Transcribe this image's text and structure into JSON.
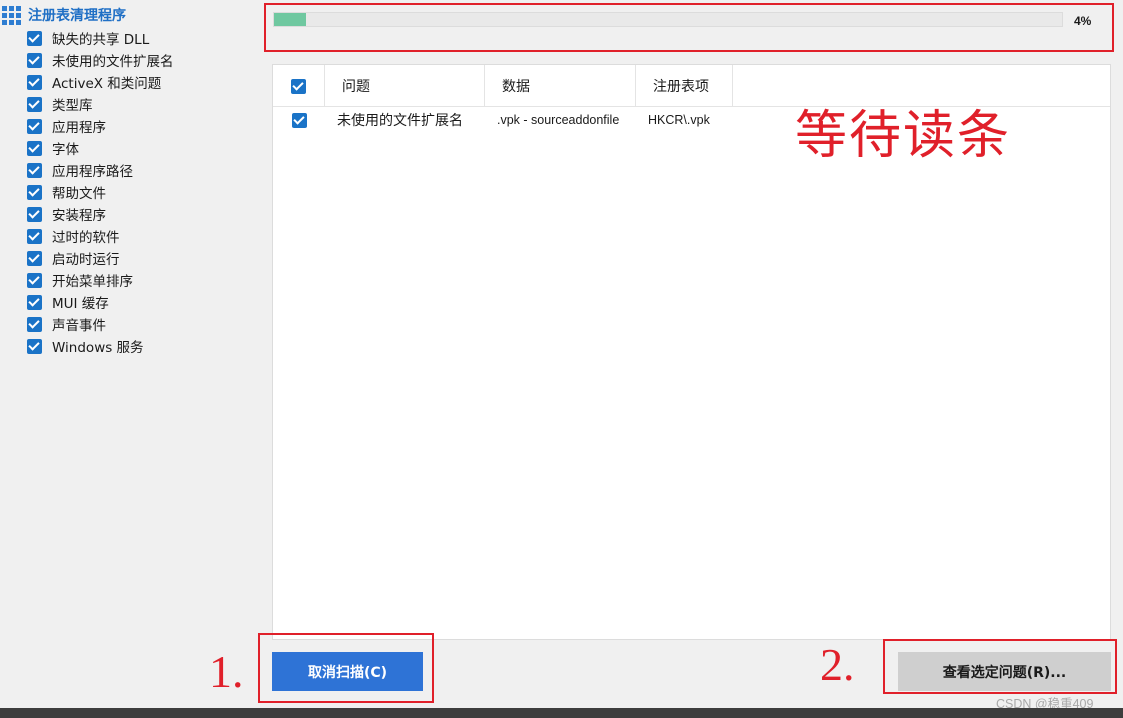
{
  "sidebar": {
    "root_label": "注册表清理程序",
    "items": [
      {
        "label": "缺失的共享 DLL",
        "checked": true
      },
      {
        "label": "未使用的文件扩展名",
        "checked": true
      },
      {
        "label": "ActiveX 和类问题",
        "checked": true
      },
      {
        "label": "类型库",
        "checked": true
      },
      {
        "label": "应用程序",
        "checked": true
      },
      {
        "label": "字体",
        "checked": true
      },
      {
        "label": "应用程序路径",
        "checked": true
      },
      {
        "label": "帮助文件",
        "checked": true
      },
      {
        "label": "安装程序",
        "checked": true
      },
      {
        "label": "过时的软件",
        "checked": true
      },
      {
        "label": "启动时运行",
        "checked": true
      },
      {
        "label": "开始菜单排序",
        "checked": true
      },
      {
        "label": "MUI 缓存",
        "checked": true
      },
      {
        "label": "声音事件",
        "checked": true
      },
      {
        "label": "Windows 服务",
        "checked": true
      }
    ]
  },
  "progress": {
    "percent_label": "4%",
    "value": 0.04
  },
  "table": {
    "columns": [
      "问题",
      "数据",
      "注册表项"
    ],
    "select_all_checked": true,
    "rows": [
      {
        "checked": true,
        "issue": "未使用的文件扩展名",
        "data": ".vpk - sourceaddonfile",
        "key": "HKCR\\.vpk"
      }
    ]
  },
  "annotations": {
    "waiting": "等待读条",
    "step1": "1.",
    "step2": "2."
  },
  "buttons": {
    "cancel_scan": "取消扫描(C)",
    "review_selected": "查看选定问题(R)..."
  },
  "watermark": "CSDN @稳重409",
  "colors": {
    "accent_blue": "#2e73d6",
    "progress_fill": "#6fc8a0",
    "annotation_red": "#e0202a"
  }
}
